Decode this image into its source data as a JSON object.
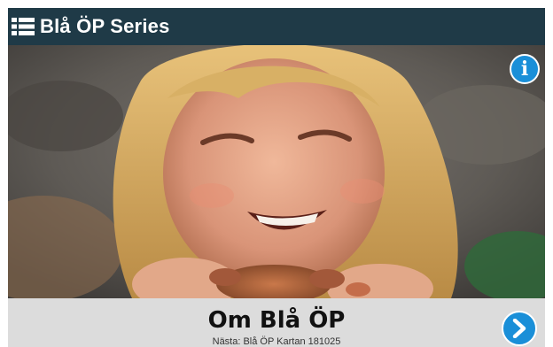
{
  "header": {
    "menu_icon": "list-icon",
    "title": "Blå ÖP Series"
  },
  "hero": {
    "image": "child-holding-crab-photo",
    "info_icon": "info-icon",
    "info_glyph": "i"
  },
  "footer": {
    "series_title": "Om Blå ÖP",
    "next_label": "Nästa: Blå ÖP Kartan 181025",
    "next_icon": "chevron-right-icon"
  },
  "colors": {
    "header_bg": "#1f3a47",
    "footer_bg": "#dcdcdc",
    "accent": "#1a8fd8"
  }
}
